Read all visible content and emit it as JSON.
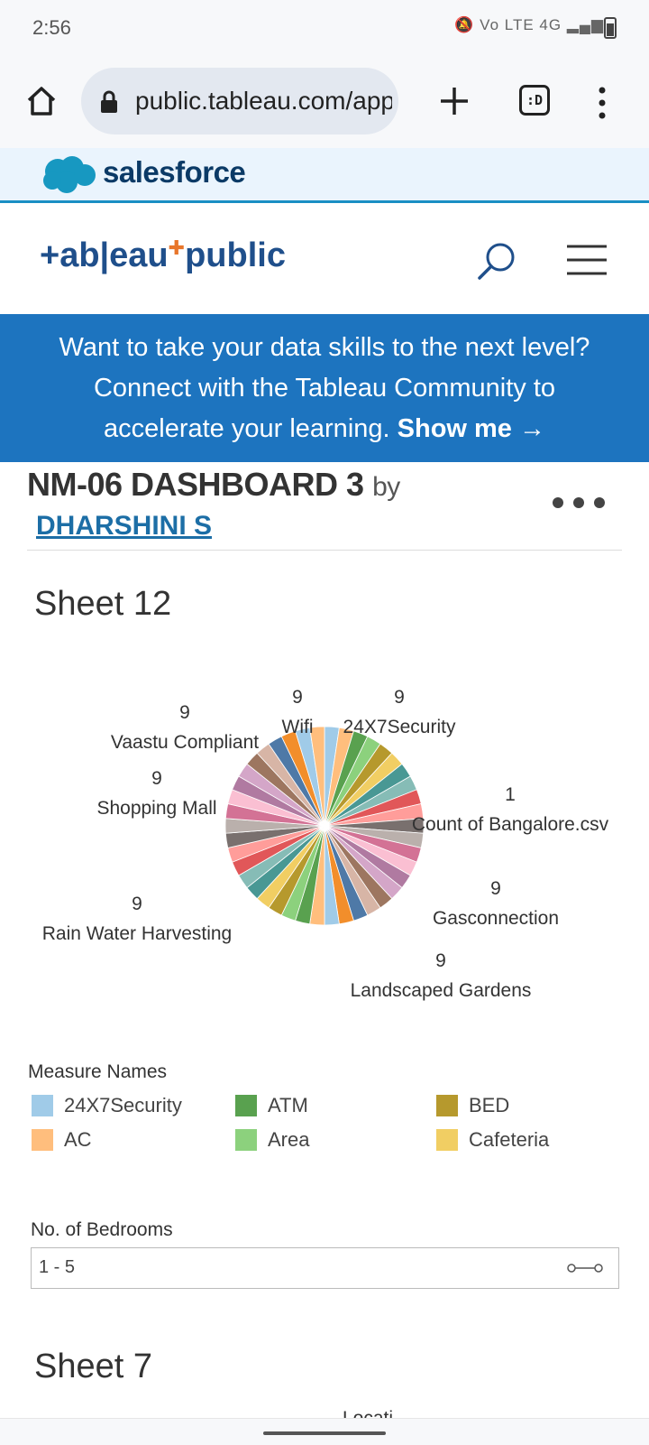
{
  "status_bar": {
    "time": "2:56",
    "icons": "🔕 Vo LTE 4G ▂▄▆",
    "icon_names": [
      "mute-icon",
      "volte-icon",
      "4g-icon",
      "signal-icon",
      "battery-icon"
    ]
  },
  "browser": {
    "url": "public.tableau.com/app/profile",
    "icons": [
      "home-icon",
      "lock-icon",
      "plus-icon",
      "tabs-icon",
      "overflow-menu-icon"
    ],
    "tabs_label": ":D"
  },
  "salesforce": {
    "brand": "salesforce"
  },
  "tableau": {
    "logo_left": "+ab|eau",
    "logo_right": "public",
    "icons": [
      "search-icon",
      "hamburger-menu-icon"
    ]
  },
  "banner": {
    "line1": "Want to take your data skills to the next level?",
    "line2": "Connect with the Tableau Community to",
    "line3_prefix": "accelerate your learning. ",
    "cta": "Show me →",
    "background": "#1d74bf"
  },
  "dashboard": {
    "title": "NM-06 DASHBOARD 3",
    "by": "by",
    "author": "DHARSHINI S"
  },
  "sheet12": {
    "title": "Sheet 12",
    "pie_labels": [
      {
        "value": "9",
        "name": "Vaastu Compliant"
      },
      {
        "value": "9",
        "name": "Wifi"
      },
      {
        "value": "9",
        "name": "24X7Security"
      },
      {
        "value": "9",
        "name": "Shopping Mall"
      },
      {
        "value": "1",
        "name": "Count of Bangalore.csv"
      },
      {
        "value": "9",
        "name": "Rain Water Harvesting"
      },
      {
        "value": "9",
        "name": "Gasconnection"
      },
      {
        "value": "9",
        "name": "Landscaped Gardens"
      }
    ],
    "slice_colors": [
      "#a0cbe8",
      "#ffbe7d",
      "#59a14f",
      "#8cd17d",
      "#b6992d",
      "#f1ce63",
      "#499894",
      "#86bcb6",
      "#e15759",
      "#ff9d9a",
      "#79706e",
      "#bab0ac",
      "#d37295",
      "#fabfd2",
      "#b07aa1",
      "#d4a6c8",
      "#9d7660",
      "#d7b5a6",
      "#4e79a7",
      "#f28e2b"
    ]
  },
  "legend": {
    "title": "Measure Names",
    "items": [
      {
        "label": "24X7Security",
        "color": "#a0cbe8"
      },
      {
        "label": "ATM",
        "color": "#59a14f"
      },
      {
        "label": "BED",
        "color": "#b6992d"
      },
      {
        "label": "AC",
        "color": "#ffbe7d"
      },
      {
        "label": "Area",
        "color": "#8cd17d"
      },
      {
        "label": "Cafeteria",
        "color": "#f1ce63"
      }
    ]
  },
  "filter": {
    "title": "No. of Bedrooms",
    "value": "1 - 5",
    "icon": "range-slider-icon"
  },
  "sheet7": {
    "title": "Sheet 7",
    "partial_text": "Locati"
  }
}
